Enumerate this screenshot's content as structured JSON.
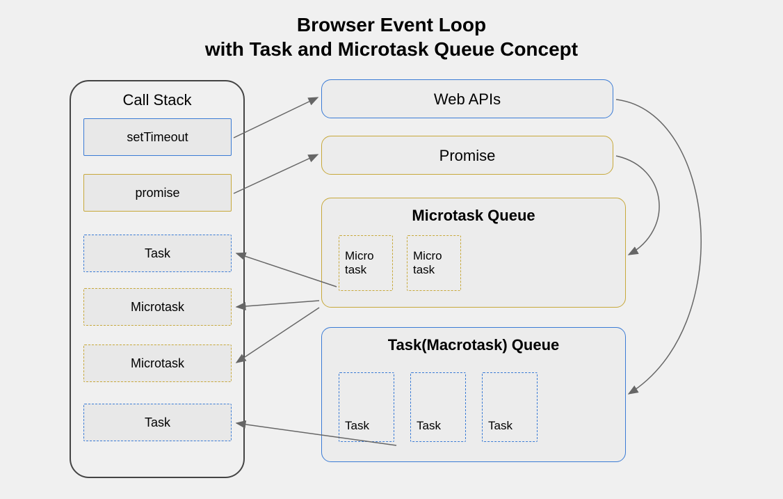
{
  "title_line1": "Browser Event Loop",
  "title_line2": "with Task and Microtask Queue Concept",
  "call_stack": {
    "label": "Call Stack",
    "items": [
      {
        "label": "setTimeout",
        "style": "blue-solid"
      },
      {
        "label": "promise",
        "style": "yellow-solid"
      },
      {
        "label": "Task",
        "style": "blue-dashed"
      },
      {
        "label": "Microtask",
        "style": "yellow-dashed"
      },
      {
        "label": "Microtask",
        "style": "yellow-dashed"
      },
      {
        "label": "Task",
        "style": "blue-dashed"
      }
    ]
  },
  "web_apis": {
    "label": "Web APIs"
  },
  "promise": {
    "label": "Promise"
  },
  "microtask_queue": {
    "label": "Microtask Queue",
    "items": [
      {
        "label": "Micro task"
      },
      {
        "label": "Micro task"
      }
    ]
  },
  "task_queue": {
    "label": "Task(Macrotask) Queue",
    "items": [
      {
        "label": "Task"
      },
      {
        "label": "Task"
      },
      {
        "label": "Task"
      }
    ]
  },
  "colors": {
    "blue": "#3a7bd5",
    "yellow": "#c7a83a",
    "arrow": "#666"
  }
}
